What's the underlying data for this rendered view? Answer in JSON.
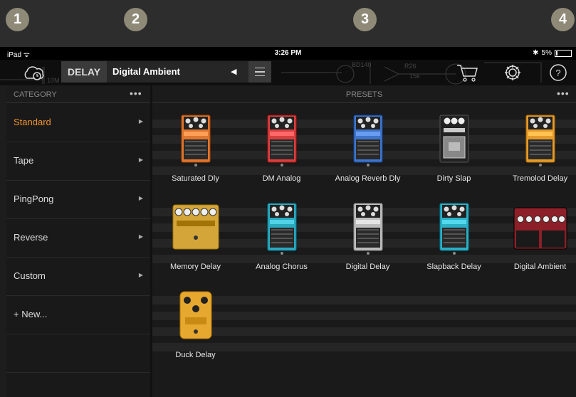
{
  "callouts": [
    "1",
    "2",
    "3",
    "4"
  ],
  "status_bar": {
    "device": "iPad",
    "time": "3:26 PM",
    "battery": "5%"
  },
  "toolbar": {
    "effect_type": "DELAY",
    "preset_name": "Digital Ambient",
    "schematic_labels": [
      "2n7",
      "10M",
      "BD140",
      "R26",
      "15k"
    ]
  },
  "category_panel": {
    "title": "CATEGORY",
    "items": [
      {
        "label": "Standard",
        "active": true
      },
      {
        "label": "Tape"
      },
      {
        "label": "PingPong"
      },
      {
        "label": "Reverse"
      },
      {
        "label": "Custom"
      },
      {
        "label": "+ New..."
      }
    ]
  },
  "presets_panel": {
    "title": "PRESETS",
    "presets": [
      {
        "label": "Saturated Dly",
        "color": "#e0762f",
        "style": "standard"
      },
      {
        "label": "DM Analog",
        "color": "#d84040",
        "style": "standard"
      },
      {
        "label": "Analog Reverb Dly",
        "color": "#3f74c9",
        "style": "standard"
      },
      {
        "label": "Dirty Slap",
        "color": "#3a3a3a",
        "style": "vintage"
      },
      {
        "label": "Tremolod Delay",
        "color": "#e59b2a",
        "style": "standard"
      },
      {
        "label": "Memory Delay",
        "color": "#d4a63a",
        "style": "wide"
      },
      {
        "label": "Analog Chorus",
        "color": "#2aaabf",
        "style": "standard"
      },
      {
        "label": "Digital Delay",
        "color": "#bdbdbd",
        "style": "standard"
      },
      {
        "label": "Slapback Delay",
        "color": "#2bb0c6",
        "style": "standard"
      },
      {
        "label": "Digital Ambient",
        "color": "#8c1f27",
        "style": "double"
      },
      {
        "label": "Duck Delay",
        "color": "#e6a82e",
        "style": "round"
      }
    ]
  },
  "colors": {
    "accent": "#f0932e",
    "background": "#1a1a1a"
  }
}
